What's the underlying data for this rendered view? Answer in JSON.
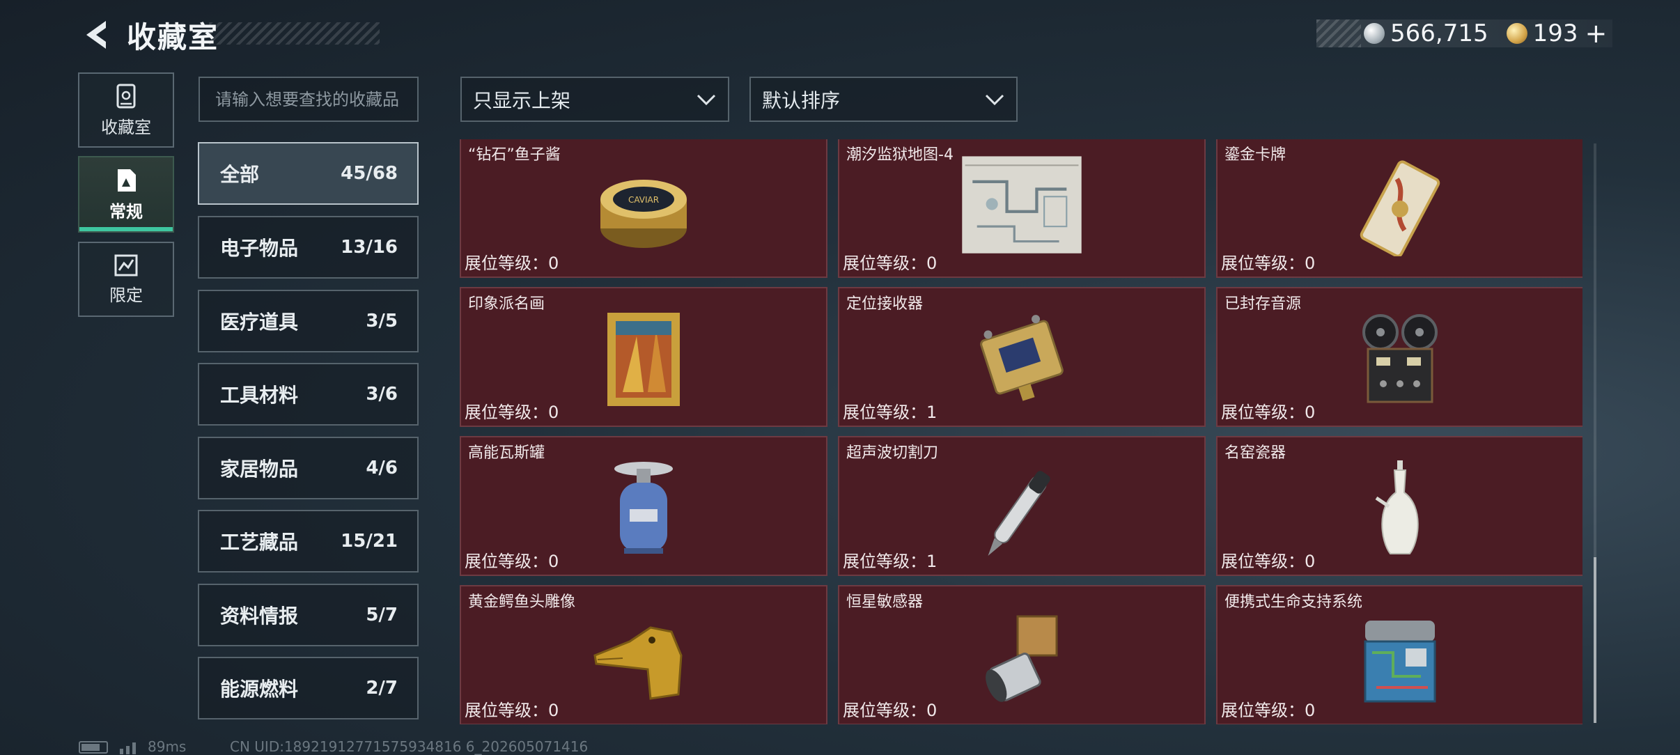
{
  "header": {
    "title": "收藏室",
    "currency": [
      {
        "name": "silver-coin",
        "value": "566,715"
      },
      {
        "name": "gold-coin",
        "value": "193"
      }
    ],
    "add_label": "+"
  },
  "left_nav": [
    {
      "label": "收藏室",
      "icon": "collection-room-icon",
      "active": false
    },
    {
      "label": "常规",
      "icon": "regular-icon",
      "active": true
    },
    {
      "label": "限定",
      "icon": "limited-icon",
      "active": false
    }
  ],
  "search": {
    "placeholder": "请输入想要查找的收藏品",
    "value": ""
  },
  "filters": {
    "shelf_filter": "只显示上架",
    "sort": "默认排序"
  },
  "categories": [
    {
      "name": "全部",
      "count": "45/68",
      "active": true
    },
    {
      "name": "电子物品",
      "count": "13/16"
    },
    {
      "name": "医疗道具",
      "count": "3/5"
    },
    {
      "name": "工具材料",
      "count": "3/6"
    },
    {
      "name": "家居物品",
      "count": "4/6"
    },
    {
      "name": "工艺藏品",
      "count": "15/21"
    },
    {
      "name": "资料情报",
      "count": "5/7"
    },
    {
      "name": "能源燃料",
      "count": "2/7"
    }
  ],
  "items": [
    {
      "name": "“钻石”鱼子酱",
      "level": "展位等级：0",
      "icon": "caviar-tin-icon"
    },
    {
      "name": "潮汐监狱地图-4",
      "level": "展位等级：0",
      "icon": "prison-map-icon"
    },
    {
      "name": "鎏金卡牌",
      "level": "展位等级：0",
      "icon": "gilded-card-icon"
    },
    {
      "name": "印象派名画",
      "level": "展位等级：0",
      "icon": "painting-icon"
    },
    {
      "name": "定位接收器",
      "level": "展位等级：1",
      "icon": "locator-receiver-icon"
    },
    {
      "name": "已封存音源",
      "level": "展位等级：0",
      "icon": "reel-recorder-icon"
    },
    {
      "name": "高能瓦斯罐",
      "level": "展位等级：0",
      "icon": "gas-canister-icon"
    },
    {
      "name": "超声波切割刀",
      "level": "展位等级：1",
      "icon": "ultrasonic-cutter-icon"
    },
    {
      "name": "名窑瓷器",
      "level": "展位等级：0",
      "icon": "porcelain-vase-icon"
    },
    {
      "name": "黄金鳄鱼头雕像",
      "level": "展位等级：0",
      "icon": "gold-crocodile-icon"
    },
    {
      "name": "恒星敏感器",
      "level": "展位等级：0",
      "icon": "star-sensor-icon"
    },
    {
      "name": "便携式生命支持系统",
      "level": "展位等级：0",
      "icon": "life-support-icon"
    }
  ],
  "footer": {
    "ping": "89ms",
    "uid": "CN UID:18921912771575934816 6_202605071416"
  }
}
